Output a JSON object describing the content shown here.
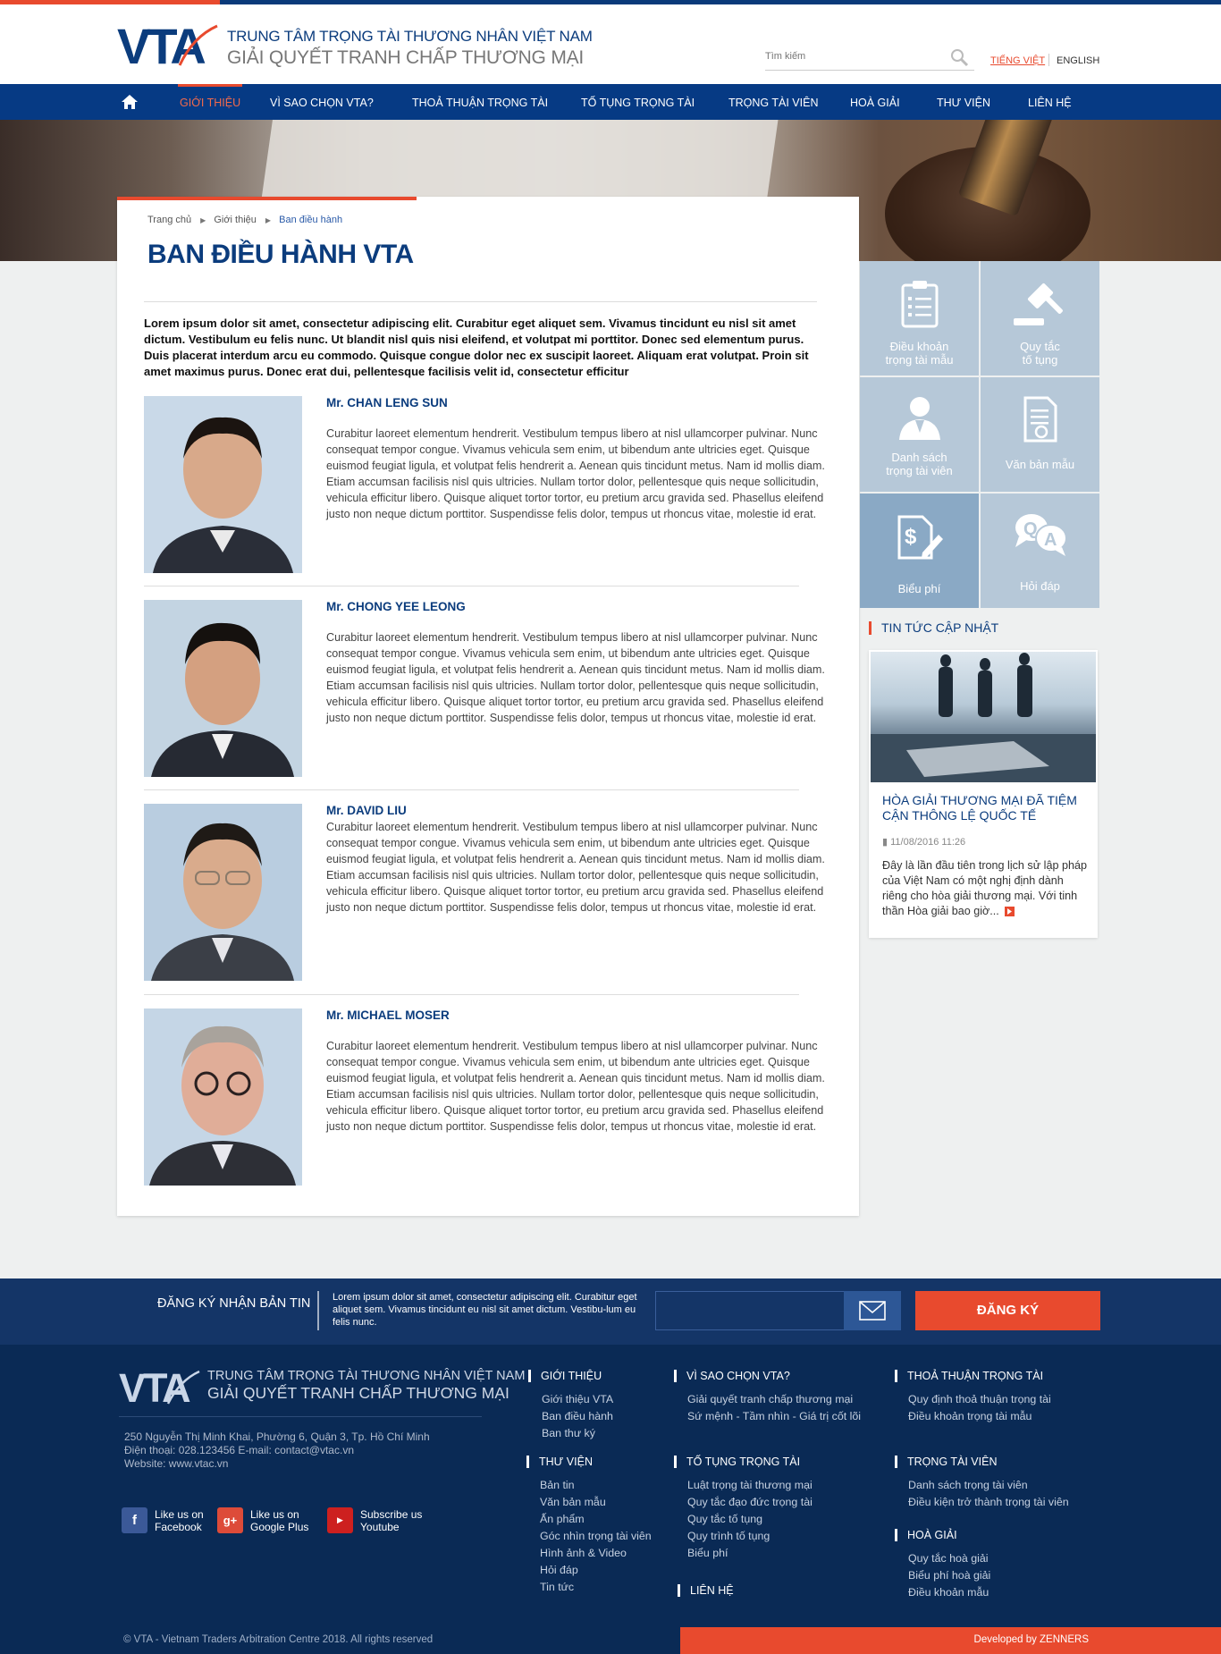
{
  "header": {
    "org_line1": "TRUNG TÂM TRỌNG TÀI THƯƠNG NHÂN VIỆT NAM",
    "org_line2": "GIẢI QUYẾT TRANH CHẤP THƯƠNG MẠI",
    "search_placeholder": "Tìm kiếm",
    "lang_vi": "TIẾNG VIỆT",
    "lang_en": "ENGLISH"
  },
  "nav": [
    "GIỚI THIỆU",
    "VÌ SAO CHỌN VTA?",
    "THOẢ THUẬN TRỌNG TÀI",
    "TỐ TỤNG TRỌNG TÀI",
    "TRỌNG TÀI VIÊN",
    "HOÀ GIẢI",
    "THƯ VIỆN",
    "LIÊN HỆ"
  ],
  "breadcrumb": [
    "Trang chủ",
    "Giới thiệu",
    "Ban điều hành"
  ],
  "page_title": "BAN ĐIỀU HÀNH VTA",
  "intro": "Lorem ipsum dolor sit amet, consectetur adipiscing elit. Curabitur eget aliquet sem. Vivamus tincidunt eu nisl sit amet dictum. Vestibulum eu felis nunc. Ut blandit nisl quis nisi eleifend, et volutpat mi porttitor. Donec sed elementum purus. Duis placerat interdum arcu eu commodo. Quisque congue dolor nec ex suscipit laoreet. Aliquam erat volutpat. Proin sit amet maximus purus. Donec erat dui, pellentesque facilisis velit id, consectetur efficitur",
  "members": [
    {
      "name": "Mr. CHAN  LENG SUN",
      "bio": "Curabitur laoreet elementum hendrerit. Vestibulum tempus libero at nisl ullamcorper pulvinar. Nunc consequat tempor congue. Vivamus vehicula sem enim, ut bibendum ante ultricies eget. Quisque euismod feugiat ligula, et volutpat felis hendrerit a. Aenean quis tincidunt metus. Nam id mollis diam. Etiam accumsan facilisis nisl quis ultricies. Nullam tortor dolor, pellentesque quis neque sollicitudin, vehicula efficitur libero. Quisque aliquet tortor tortor, eu pretium arcu gravida sed. Phasellus eleifend justo non neque dictum porttitor. Suspendisse felis dolor, tempus ut rhoncus vitae, molestie id erat."
    },
    {
      "name": "Mr. CHONG YEE LEONG",
      "bio": "Curabitur laoreet elementum hendrerit. Vestibulum tempus libero at nisl ullamcorper pulvinar. Nunc consequat tempor congue. Vivamus vehicula sem enim, ut bibendum ante ultricies eget. Quisque euismod feugiat ligula, et volutpat felis hendrerit a. Aenean quis tincidunt metus. Nam id mollis diam. Etiam accumsan facilisis nisl quis ultricies. Nullam tortor dolor, pellentesque quis neque sollicitudin, vehicula efficitur libero. Quisque aliquet tortor tortor, eu pretium arcu gravida sed. Phasellus eleifend justo non neque dictum porttitor. Suspendisse felis dolor, tempus ut rhoncus vitae, molestie id erat."
    },
    {
      "name": "Mr. DAVID LIU",
      "bio": "Curabitur laoreet elementum hendrerit. Vestibulum tempus libero at nisl ullamcorper pulvinar. Nunc consequat tempor congue. Vivamus vehicula sem enim, ut bibendum ante ultricies eget. Quisque euismod feugiat ligula, et volutpat felis hendrerit a. Aenean quis tincidunt metus. Nam id mollis diam. Etiam accumsan facilisis nisl quis ultricies. Nullam tortor dolor, pellentesque quis neque sollicitudin, vehicula efficitur libero. Quisque aliquet tortor tortor, eu pretium arcu gravida sed. Phasellus eleifend justo non neque dictum porttitor. Suspendisse felis dolor, tempus ut rhoncus vitae, molestie id erat."
    },
    {
      "name": "Mr. MICHAEL MOSER",
      "bio": "Curabitur laoreet elementum hendrerit. Vestibulum tempus libero at nisl ullamcorper pulvinar. Nunc consequat tempor congue. Vivamus vehicula sem enim, ut bibendum ante ultricies eget. Quisque euismod feugiat ligula, et volutpat felis hendrerit a. Aenean quis tincidunt metus. Nam id mollis diam. Etiam accumsan facilisis nisl quis ultricies. Nullam tortor dolor, pellentesque quis neque sollicitudin, vehicula efficitur libero. Quisque aliquet tortor tortor, eu pretium arcu gravida sed. Phasellus eleifend justo non neque dictum porttitor. Suspendisse felis dolor, tempus ut rhoncus vitae, molestie id erat."
    }
  ],
  "sidebar": {
    "tiles": [
      {
        "line1": "Điều khoản",
        "line2": "trọng tài mẫu",
        "icon": "clipboard-icon"
      },
      {
        "line1": "Quy tắc",
        "line2": "tố tụng",
        "icon": "gavel-icon"
      },
      {
        "line1": "Danh sách",
        "line2": "trọng tài viên",
        "icon": "person-icon"
      },
      {
        "line1": "Văn bản mẫu",
        "line2": "",
        "icon": "document-icon"
      },
      {
        "line1": "Biểu phí",
        "line2": "",
        "icon": "fee-icon"
      },
      {
        "line1": "Hỏi đáp",
        "line2": "",
        "icon": "qa-icon"
      }
    ],
    "news_heading": "TIN TỨC CẬP NHẬT",
    "news_title": "HÒA GIẢI THƯƠNG MẠI ĐÃ TIỆM CẬN THÔNG LỆ QUỐC TẾ",
    "news_date": "11/08/2016 11:26",
    "news_excerpt": "Đây là lần đầu tiên trong lịch sử lập pháp của Việt Nam có một nghị định dành riêng cho hòa giải thương mại. Với tinh thần Hòa giải bao giờ..."
  },
  "newsletter": {
    "heading": "ĐĂNG KÝ NHẬN BẢN TIN",
    "description": "Lorem ipsum dolor sit amet, consectetur adipiscing elit. Curabitur eget aliquet sem. Vivamus tincidunt eu nisl sit amet dictum. Vestibu-lum eu felis nunc.",
    "button": "ĐĂNG KÝ"
  },
  "footer": {
    "org_line1": "TRUNG TÂM TRỌNG TÀI THƯƠNG NHÂN VIỆT NAM",
    "org_line2": "GIẢI QUYẾT TRANH CHẤP THƯƠNG MẠI",
    "address": "250 Nguyễn Thị Minh Khai, Phường 6, Quận 3, Tp. Hồ Chí Minh",
    "phone": "Điện thoại: 028.123456 E-mail: contact@vtac.vn",
    "website": "Website: www.vtac.vn",
    "social": [
      {
        "line1": "Like us on",
        "line2": "Facebook",
        "icon": "facebook-icon",
        "color": "#3b5998"
      },
      {
        "line1": "Like us on",
        "line2": "Google Plus",
        "icon": "googleplus-icon",
        "color": "#dd4b39"
      },
      {
        "line1": "Subscribe us",
        "line2": "Youtube",
        "icon": "youtube-icon",
        "color": "#cd201f"
      }
    ],
    "columns": [
      {
        "title": "GIỚI THIỆU",
        "links": [
          "Giới thiệu VTA",
          "Ban điều hành",
          "Ban thư ký"
        ]
      },
      {
        "title": "VÌ SAO CHỌN VTA?",
        "links": [
          "Giải quyết tranh chấp thương mại",
          "Sứ mệnh - Tầm  nhìn - Giá trị cốt lõi"
        ]
      },
      {
        "title": "THOẢ THUẬN TRỌNG TÀI",
        "links": [
          "Quy định thoả thuận trọng tài",
          "Điều khoản trọng tài mẫu"
        ]
      },
      {
        "title": "THƯ VIỆN",
        "links": [
          "Bản tin",
          "Văn bản mẫu",
          "Ấn phẩm",
          "Góc nhìn trọng tài viên",
          "Hình ảnh & Video",
          "Hỏi đáp",
          "Tin tức"
        ]
      },
      {
        "title": "TỐ TỤNG TRỌNG TÀI",
        "links": [
          "Luật trọng tài thương mại",
          "Quy tắc đạo đức trọng tài",
          "Quy tắc tố tụng",
          "Quy trình tố tụng",
          "Biểu phí"
        ]
      },
      {
        "title": "TRỌNG TÀI VIÊN",
        "links": [
          "Danh sách trọng tài viên",
          "Điều kiện trở thành trọng tài viên"
        ]
      },
      {
        "title": "LIÊN HỆ",
        "links": []
      },
      {
        "title": "HOÀ GIẢI",
        "links": [
          "Quy tắc hoà giải",
          "Biểu phí hoà giải",
          "Điều khoản mẫu"
        ]
      }
    ],
    "copyright": "© VTA - Vietnam Traders Arbitration Centre  2018. All rights reserved",
    "developer": "Developed by ZENNERS"
  },
  "colors": {
    "navy": "#063a84",
    "accent": "#e84a2e",
    "tile": "#b6c8d8",
    "footer": "#0a2a55"
  }
}
